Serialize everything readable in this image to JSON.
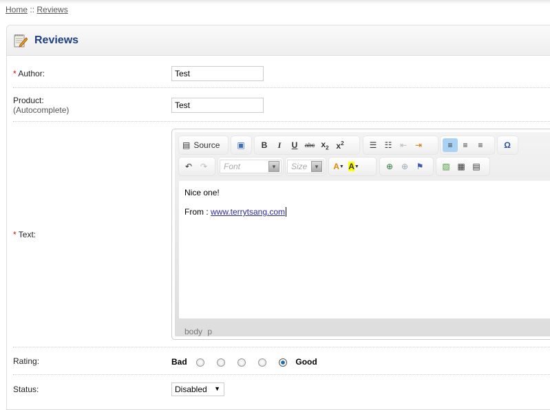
{
  "breadcrumb": {
    "home": "Home",
    "sep": "::",
    "current": "Reviews"
  },
  "panel": {
    "title": "Reviews"
  },
  "form": {
    "author": {
      "label": "Author:",
      "value": "Test",
      "required": "*"
    },
    "product": {
      "label": "Product:",
      "hint": "(Autocomplete)",
      "value": "Test"
    },
    "text": {
      "label": "Text:",
      "required": "*"
    },
    "rating": {
      "label": "Rating:",
      "low": "Bad",
      "high": "Good",
      "selected": 5
    },
    "status": {
      "label": "Status:",
      "value": "Disabled"
    }
  },
  "editor": {
    "source_label": "Source",
    "font_placeholder": "Font",
    "size_placeholder": "Size",
    "content_line1": "Nice one!",
    "content_prefix": "From : ",
    "content_link": "www.terrytsang.com",
    "path": "body p"
  }
}
